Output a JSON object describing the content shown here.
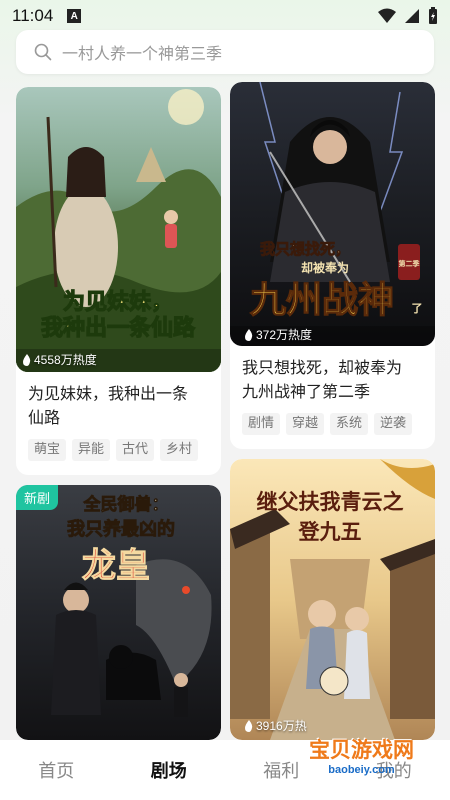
{
  "status": {
    "time": "11:04",
    "indicator": "A"
  },
  "search": {
    "placeholder": "一村人养一个神第三季"
  },
  "cards": [
    {
      "poster_text": [
        "为见妹妹，",
        "我种出一条仙路"
      ],
      "heat": "4558万热度",
      "title_lines": [
        "为见妹妹，我种出一条",
        "仙路"
      ],
      "tags": [
        "萌宝",
        "异能",
        "古代",
        "乡村"
      ]
    },
    {
      "poster_text": [
        "我只想找死，",
        "却被奉为",
        "九州战神",
        "了",
        "第二季"
      ],
      "heat": "372万热度",
      "title_lines": [
        "我只想找死，却被奉为",
        "九州战神了第二季"
      ],
      "tags": [
        "剧情",
        "穿越",
        "系统",
        "逆袭"
      ]
    },
    {
      "badge": "新剧",
      "poster_text": [
        "全民御兽：",
        "我只养最凶的",
        "龙皇"
      ]
    },
    {
      "poster_text": [
        "继父扶我青云之",
        "登九五"
      ],
      "heat": "3916万热"
    }
  ],
  "tabs": [
    "首页",
    "剧场",
    "福利",
    "我的"
  ],
  "watermark": {
    "main": "宝贝游戏网",
    "sub": "baobeiy.com"
  },
  "colors": {
    "accent_green": "#1fc4a0",
    "heat_white": "#ffffff",
    "tab_active": "#111111"
  }
}
